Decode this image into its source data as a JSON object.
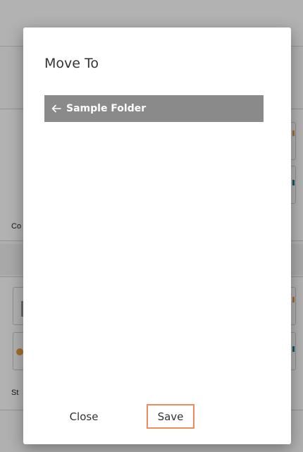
{
  "background": {
    "labels": [
      "Co",
      "St"
    ],
    "accent_orange": "#f0a040",
    "accent_teal": "#1a7f9a"
  },
  "dialog": {
    "title": "Move To",
    "folder_path": {
      "back_icon": "arrow-left-icon",
      "name": "Sample Folder"
    },
    "buttons": {
      "close_label": "Close",
      "save_label": "Save"
    },
    "colors": {
      "folder_bar": "#8a8a8a",
      "save_outline": "#f08a5d"
    }
  }
}
